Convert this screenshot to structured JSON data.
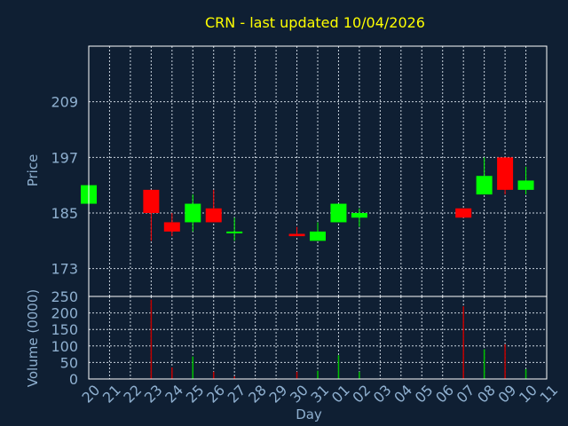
{
  "colors": {
    "background": "#0f1f33",
    "title": "#ffff00",
    "axis_text": "#8fb0d0",
    "grid": "#c9d3dd",
    "frame": "#ffffff",
    "up": "#00ff00",
    "down": "#ff0000",
    "up_volume": "#00c000",
    "down_volume": "#c00000"
  },
  "chart_data": [
    {
      "type": "candlestick",
      "title": "CRN - last updated 10/04/2026",
      "ylabel": "Price",
      "ylim": [
        167,
        221
      ],
      "yticks": [
        173,
        185,
        197,
        209
      ],
      "grid": true,
      "x_tick_labels": [
        "20",
        "21",
        "22",
        "23",
        "24",
        "25",
        "26",
        "27",
        "28",
        "29",
        "30",
        "31",
        "01",
        "02",
        "03",
        "04",
        "05",
        "06",
        "07",
        "08",
        "09",
        "10",
        "11"
      ],
      "candles": [
        {
          "x": "20",
          "open": 187,
          "high": 191,
          "low": 187,
          "close": 191
        },
        {
          "x": "23",
          "open": 190,
          "high": 190,
          "low": 179,
          "close": 185
        },
        {
          "x": "24",
          "open": 183,
          "high": 185,
          "low": 180,
          "close": 181
        },
        {
          "x": "25",
          "open": 183,
          "high": 189,
          "low": 181,
          "close": 187
        },
        {
          "x": "26",
          "open": 186,
          "high": 190,
          "low": 183,
          "close": 183
        },
        {
          "x": "27",
          "open": 181,
          "high": 184,
          "low": 179,
          "close": 181
        },
        {
          "x": "30",
          "open": 180.5,
          "high": 182,
          "low": 180,
          "close": 180
        },
        {
          "x": "31",
          "open": 179,
          "high": 183,
          "low": 179,
          "close": 181
        },
        {
          "x": "01",
          "open": 183,
          "high": 187,
          "low": 183,
          "close": 187
        },
        {
          "x": "02",
          "open": 184,
          "high": 186,
          "low": 182,
          "close": 185
        },
        {
          "x": "07",
          "open": 186,
          "high": 186,
          "low": 184,
          "close": 184
        },
        {
          "x": "08",
          "open": 189,
          "high": 197,
          "low": 189,
          "close": 193
        },
        {
          "x": "09",
          "open": 197,
          "high": 197,
          "low": 189,
          "close": 190
        },
        {
          "x": "10",
          "open": 190,
          "high": 195,
          "low": 189,
          "close": 192
        }
      ]
    },
    {
      "type": "bar",
      "ylabel": "Volume (0000)",
      "xlabel": "Day",
      "ylim": [
        0,
        250
      ],
      "yticks": [
        0,
        50,
        100,
        150,
        200,
        250
      ],
      "grid": true,
      "x_tick_labels": [
        "20",
        "21",
        "22",
        "23",
        "24",
        "25",
        "26",
        "27",
        "28",
        "29",
        "30",
        "31",
        "01",
        "02",
        "03",
        "04",
        "05",
        "06",
        "07",
        "08",
        "09",
        "10",
        "11"
      ],
      "bars": [
        {
          "x": "20",
          "value": 0,
          "dir": "down"
        },
        {
          "x": "23",
          "value": 240,
          "dir": "down"
        },
        {
          "x": "24",
          "value": 35,
          "dir": "down"
        },
        {
          "x": "25",
          "value": 68,
          "dir": "up"
        },
        {
          "x": "26",
          "value": 22,
          "dir": "down"
        },
        {
          "x": "27",
          "value": 8,
          "dir": "down"
        },
        {
          "x": "30",
          "value": 22,
          "dir": "down"
        },
        {
          "x": "31",
          "value": 25,
          "dir": "up"
        },
        {
          "x": "01",
          "value": 72,
          "dir": "up"
        },
        {
          "x": "02",
          "value": 22,
          "dir": "up"
        },
        {
          "x": "07",
          "value": 220,
          "dir": "down"
        },
        {
          "x": "08",
          "value": 90,
          "dir": "up"
        },
        {
          "x": "09",
          "value": 105,
          "dir": "down"
        },
        {
          "x": "10",
          "value": 30,
          "dir": "up"
        }
      ]
    }
  ]
}
